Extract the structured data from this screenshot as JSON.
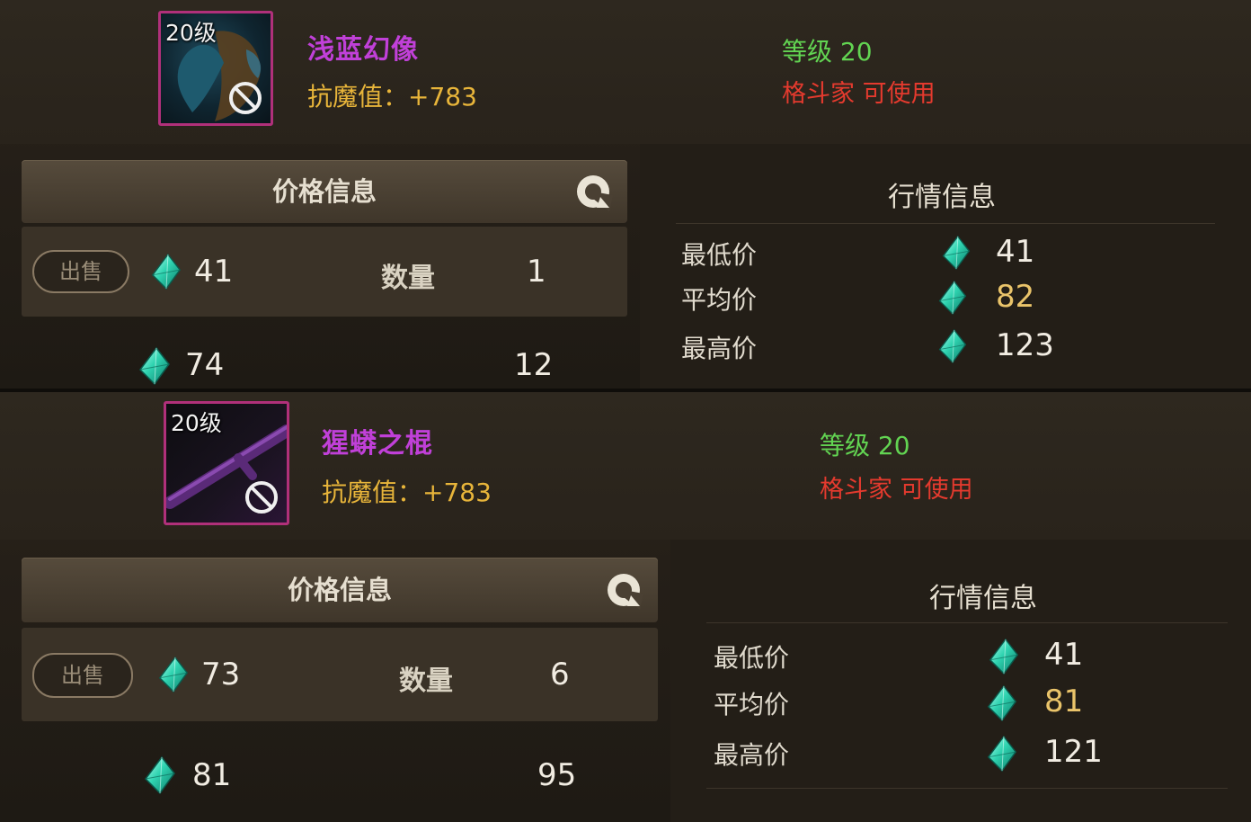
{
  "items": [
    {
      "icon_level": "20级",
      "name": "浅蓝幻像",
      "stat": "抗魔值：+783",
      "level": "等级 20",
      "class_req": "格斗家 可使用",
      "price_title": "价格信息",
      "sell_label": "出售",
      "sell_price": "41",
      "qty_label": "数量",
      "qty": "1",
      "next_price": "74",
      "next_qty": "12",
      "market_title": "行情信息",
      "market": [
        {
          "label": "最低价",
          "value": "41"
        },
        {
          "label": "平均价",
          "value": "82"
        },
        {
          "label": "最高价",
          "value": "123"
        }
      ]
    },
    {
      "icon_level": "20级",
      "name": "猩蟒之棍",
      "stat": "抗魔值：+783",
      "level": "等级 20",
      "class_req": "格斗家 可使用",
      "price_title": "价格信息",
      "sell_label": "出售",
      "sell_price": "73",
      "qty_label": "数量",
      "qty": "6",
      "next_price": "81",
      "next_qty": "95",
      "market_title": "行情信息",
      "market": [
        {
          "label": "最低价",
          "value": "41"
        },
        {
          "label": "平均价",
          "value": "81"
        },
        {
          "label": "最高价",
          "value": "121"
        }
      ]
    }
  ],
  "colors": {
    "item_name": "#c040d8",
    "stat": "#e8b53a",
    "level": "#62d452",
    "class_req": "#e43a2e",
    "average_price": "#eac46a",
    "icon_border": "#b0307a"
  },
  "icons": {
    "currency": "gem-icon",
    "refresh": "refresh-icon",
    "forbidden": "forbidden-icon"
  }
}
